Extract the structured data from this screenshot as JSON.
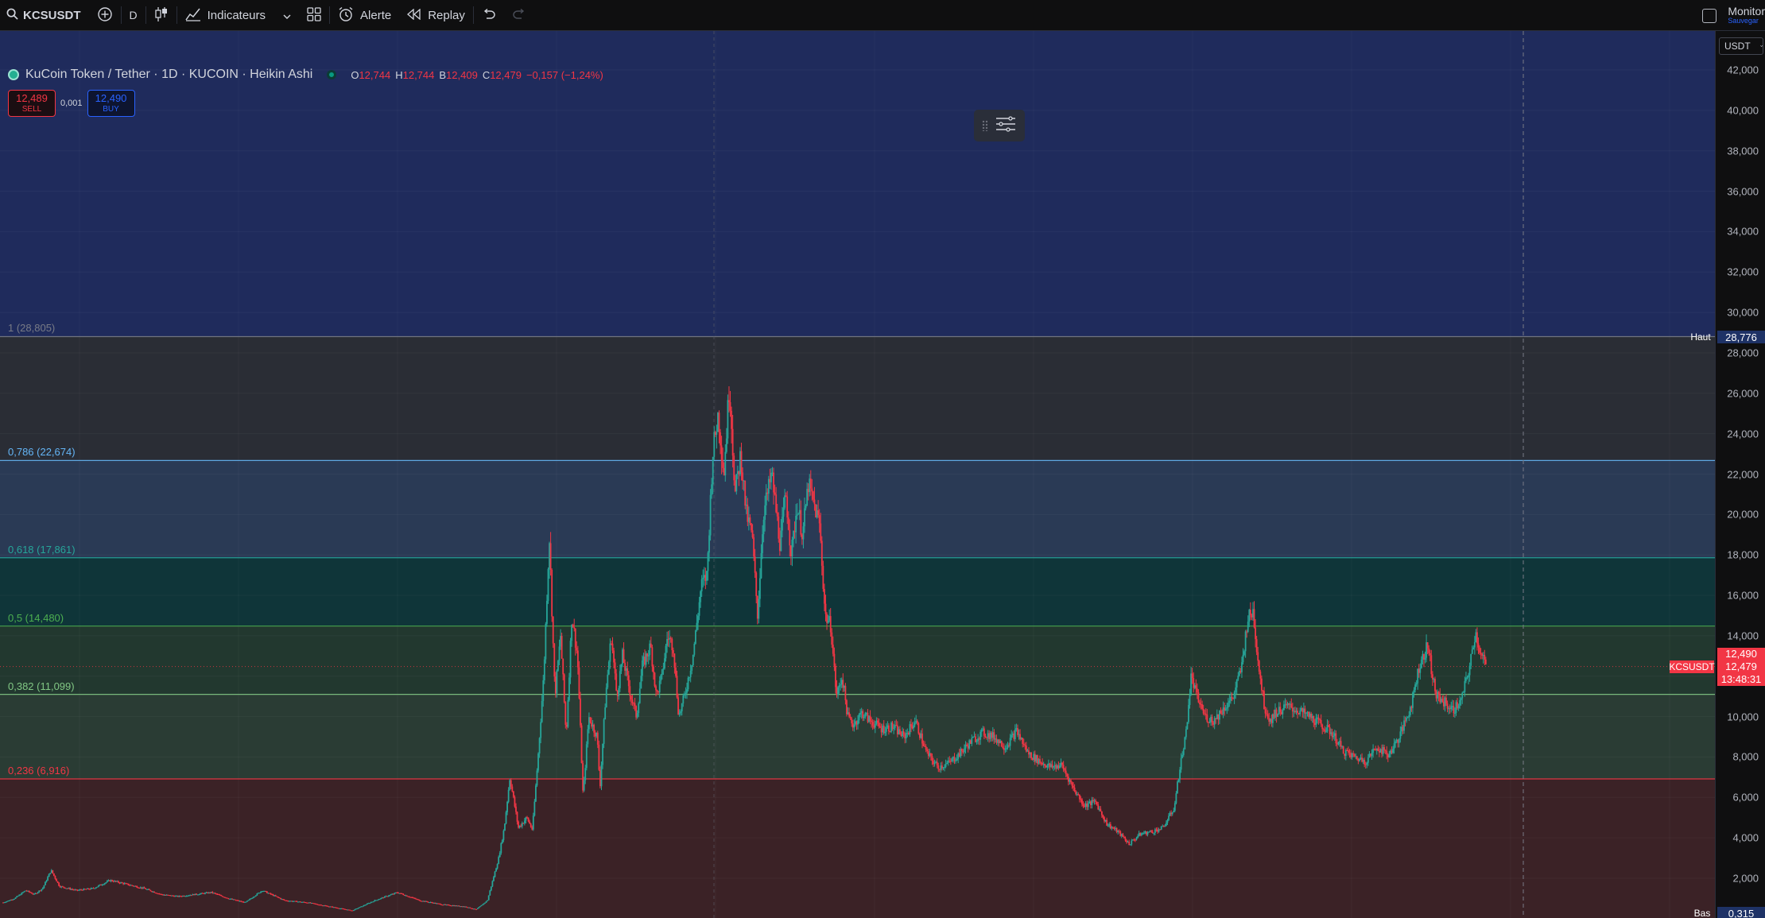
{
  "toolbar": {
    "symbol": "KCSUSDT",
    "interval": "D",
    "indicators_label": "Indicateurs",
    "alert_label": "Alerte",
    "replay_label": "Replay",
    "monitor_label": "Monitor",
    "monitor_sub": "Sauvegar",
    "icons": [
      "search-icon",
      "add-symbol-icon",
      "candle-type-icon",
      "indicators-icon",
      "chevron-down-icon",
      "layout-grid-icon",
      "alarm-icon",
      "replay-icon",
      "undo-icon",
      "redo-icon"
    ]
  },
  "legend": {
    "title": "KuCoin Token / Tether · 1D · KUCOIN · Heikin Ashi",
    "o_key": "O",
    "o_val": "12,744",
    "h_key": "H",
    "h_val": "12,744",
    "l_key": "B",
    "l_val": "12,409",
    "c_key": "C",
    "c_val": "12,479",
    "change": "−0,157 (−1,24%)"
  },
  "trade": {
    "sell_price": "12,489",
    "sell_label": "SELL",
    "spread": "0,001",
    "buy_price": "12,490",
    "buy_label": "BUY"
  },
  "price_scale": {
    "currency": "USDT",
    "ticks": [
      "42,000",
      "40,000",
      "38,000",
      "36,000",
      "34,000",
      "32,000",
      "30,000",
      "28,000",
      "26,000",
      "24,000",
      "22,000",
      "20,000",
      "18,000",
      "16,000",
      "14,000",
      "12,000",
      "10,000",
      "8,000",
      "6,000",
      "4,000",
      "2,000"
    ],
    "high_label": "Haut",
    "high_value": "28,776",
    "low_label": "Bas",
    "low_value": "0,315",
    "symbol_tag": "KCSUSDT",
    "bid": "12,490",
    "last": "12,479",
    "countdown": "13:48:31"
  },
  "fibonacci": {
    "levels": [
      {
        "label": "1 (28,805)",
        "price": 28805,
        "color": "#787b86"
      },
      {
        "label": "0,786 (22,674)",
        "price": 22674,
        "color": "#64b5f6"
      },
      {
        "label": "0,618 (17,861)",
        "price": 17861,
        "color": "#26a69a"
      },
      {
        "label": "0,5 (14,480)",
        "price": 14480,
        "color": "#4caf50"
      },
      {
        "label": "0,382 (11,099)",
        "price": 11099,
        "color": "#81c784"
      },
      {
        "label": "0,236 (6,916)",
        "price": 6916,
        "color": "#f23645"
      }
    ]
  },
  "colors": {
    "up": "#26a69a",
    "down": "#f23645",
    "background": "#131722",
    "accent": "#2962ff"
  },
  "chart_data": {
    "type": "candlestick-heikin-ashi",
    "symbol": "KCSUSDT",
    "interval": "1D",
    "ylim": [
      0,
      43000
    ],
    "path_points": [
      [
        0,
        800
      ],
      [
        20,
        1000
      ],
      [
        40,
        1400
      ],
      [
        55,
        1200
      ],
      [
        70,
        1500
      ],
      [
        85,
        2400
      ],
      [
        100,
        1600
      ],
      [
        130,
        1400
      ],
      [
        160,
        1500
      ],
      [
        190,
        1900
      ],
      [
        220,
        1700
      ],
      [
        250,
        1500
      ],
      [
        280,
        1200
      ],
      [
        310,
        1100
      ],
      [
        340,
        1200
      ],
      [
        370,
        1300
      ],
      [
        400,
        1000
      ],
      [
        430,
        800
      ],
      [
        460,
        1400
      ],
      [
        500,
        900
      ],
      [
        540,
        800
      ],
      [
        580,
        600
      ],
      [
        620,
        400
      ],
      [
        660,
        900
      ],
      [
        700,
        1300
      ],
      [
        740,
        900
      ],
      [
        780,
        700
      ],
      [
        820,
        600
      ],
      [
        840,
        450
      ],
      [
        860,
        900
      ],
      [
        880,
        3000
      ],
      [
        890,
        4500
      ],
      [
        900,
        7000
      ],
      [
        915,
        4500
      ],
      [
        930,
        5000
      ],
      [
        940,
        4400
      ],
      [
        950,
        8000
      ],
      [
        960,
        12000
      ],
      [
        970,
        19000
      ],
      [
        980,
        11000
      ],
      [
        990,
        14000
      ],
      [
        1000,
        9000
      ],
      [
        1010,
        15000
      ],
      [
        1020,
        13000
      ],
      [
        1030,
        6000
      ],
      [
        1040,
        10000
      ],
      [
        1055,
        9000
      ],
      [
        1060,
        6500
      ],
      [
        1070,
        11000
      ],
      [
        1080,
        14000
      ],
      [
        1090,
        11000
      ],
      [
        1100,
        13000
      ],
      [
        1115,
        11000
      ],
      [
        1125,
        10000
      ],
      [
        1135,
        12500
      ],
      [
        1150,
        13500
      ],
      [
        1160,
        11000
      ],
      [
        1170,
        12000
      ],
      [
        1180,
        14000
      ],
      [
        1190,
        13500
      ],
      [
        1200,
        10000
      ],
      [
        1210,
        11000
      ],
      [
        1225,
        13000
      ],
      [
        1240,
        16500
      ],
      [
        1250,
        17000
      ],
      [
        1260,
        23000
      ],
      [
        1270,
        25000
      ],
      [
        1280,
        22000
      ],
      [
        1290,
        26500
      ],
      [
        1300,
        21000
      ],
      [
        1310,
        23000
      ],
      [
        1320,
        20000
      ],
      [
        1330,
        19000
      ],
      [
        1340,
        15000
      ],
      [
        1350,
        20000
      ],
      [
        1365,
        22000
      ],
      [
        1380,
        18500
      ],
      [
        1390,
        21000
      ],
      [
        1400,
        18000
      ],
      [
        1410,
        20500
      ],
      [
        1420,
        19000
      ],
      [
        1430,
        21500
      ],
      [
        1440,
        20500
      ],
      [
        1450,
        19500
      ],
      [
        1460,
        15000
      ],
      [
        1470,
        14500
      ],
      [
        1480,
        11000
      ],
      [
        1490,
        12000
      ],
      [
        1500,
        10000
      ],
      [
        1510,
        9600
      ],
      [
        1525,
        10200
      ],
      [
        1540,
        9800
      ],
      [
        1560,
        9400
      ],
      [
        1580,
        9500
      ],
      [
        1600,
        9000
      ],
      [
        1620,
        9800
      ],
      [
        1640,
        8200
      ],
      [
        1660,
        7500
      ],
      [
        1680,
        7700
      ],
      [
        1700,
        8200
      ],
      [
        1720,
        8800
      ],
      [
        1740,
        9200
      ],
      [
        1760,
        9000
      ],
      [
        1780,
        8500
      ],
      [
        1800,
        9300
      ],
      [
        1820,
        8200
      ],
      [
        1840,
        7800
      ],
      [
        1860,
        7500
      ],
      [
        1880,
        7600
      ],
      [
        1900,
        6500
      ],
      [
        1920,
        5600
      ],
      [
        1940,
        5800
      ],
      [
        1960,
        4700
      ],
      [
        1980,
        4300
      ],
      [
        2000,
        3700
      ],
      [
        2020,
        4200
      ],
      [
        2040,
        4300
      ],
      [
        2060,
        4500
      ],
      [
        2080,
        5500
      ],
      [
        2090,
        7500
      ],
      [
        2100,
        9000
      ],
      [
        2110,
        12000
      ],
      [
        2120,
        11000
      ],
      [
        2135,
        10000
      ],
      [
        2150,
        9800
      ],
      [
        2170,
        10500
      ],
      [
        2185,
        11000
      ],
      [
        2200,
        12500
      ],
      [
        2210,
        14800
      ],
      [
        2220,
        15200
      ],
      [
        2230,
        12500
      ],
      [
        2240,
        10500
      ],
      [
        2250,
        9800
      ],
      [
        2260,
        10200
      ],
      [
        2280,
        10500
      ],
      [
        2300,
        10300
      ],
      [
        2320,
        10000
      ],
      [
        2340,
        9600
      ],
      [
        2360,
        9200
      ],
      [
        2380,
        8300
      ],
      [
        2400,
        8000
      ],
      [
        2420,
        7800
      ],
      [
        2440,
        8500
      ],
      [
        2460,
        8100
      ],
      [
        2480,
        9000
      ],
      [
        2500,
        10500
      ],
      [
        2515,
        12500
      ],
      [
        2530,
        13500
      ],
      [
        2545,
        11000
      ],
      [
        2560,
        10700
      ],
      [
        2575,
        10300
      ],
      [
        2590,
        10800
      ],
      [
        2605,
        12500
      ],
      [
        2615,
        14200
      ],
      [
        2625,
        13000
      ],
      [
        2635,
        12479
      ]
    ],
    "last_close": 12479,
    "period_high": 28776,
    "period_low": 0.315
  }
}
